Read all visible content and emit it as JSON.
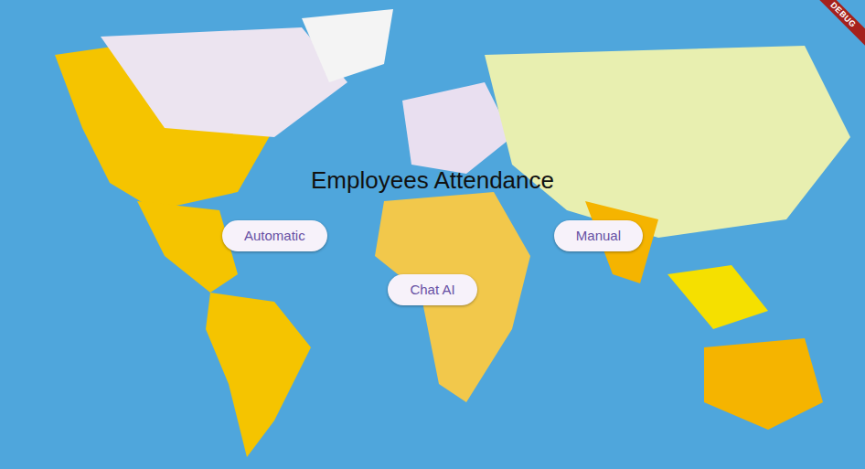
{
  "title": "Employees Attendance",
  "button_rows": [
    [
      "Automatic",
      "Manual"
    ],
    [
      "Chat AI"
    ]
  ],
  "debug_banner": "DEBUG"
}
